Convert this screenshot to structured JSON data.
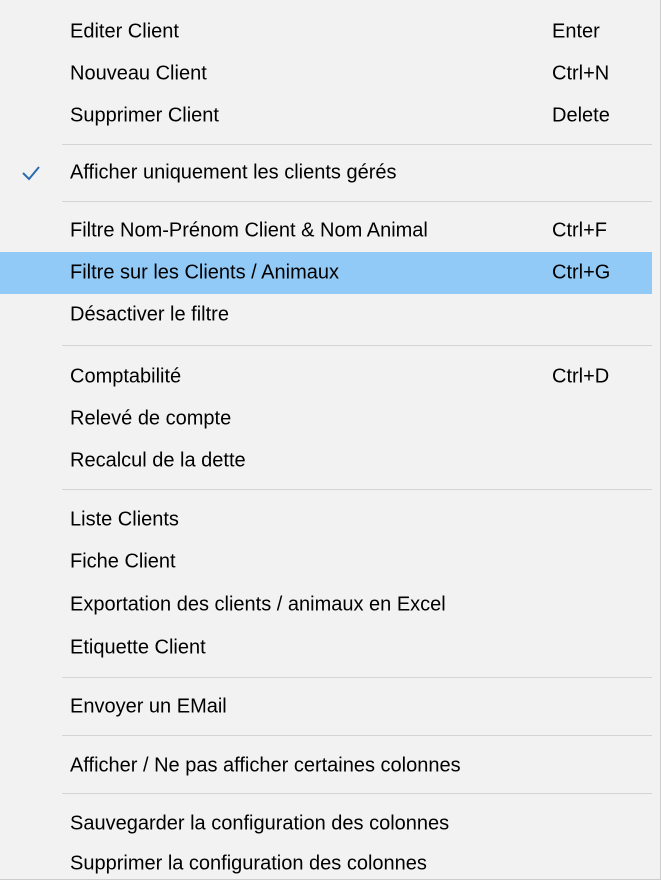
{
  "menu": {
    "items": [
      {
        "label": "Editer Client",
        "shortcut": "Enter"
      },
      {
        "label": "Nouveau Client",
        "shortcut": "Ctrl+N"
      },
      {
        "label": "Supprimer Client",
        "shortcut": "Delete"
      },
      {
        "label": "Afficher uniquement les clients gérés",
        "shortcut": "",
        "checked": true
      },
      {
        "label": "Filtre Nom-Prénom Client & Nom Animal",
        "shortcut": "Ctrl+F"
      },
      {
        "label": "Filtre sur les Clients / Animaux",
        "shortcut": "Ctrl+G",
        "highlighted": true
      },
      {
        "label": "Désactiver le filtre",
        "shortcut": ""
      },
      {
        "label": "Comptabilité",
        "shortcut": "Ctrl+D"
      },
      {
        "label": "Relevé de compte",
        "shortcut": ""
      },
      {
        "label": "Recalcul de la dette",
        "shortcut": ""
      },
      {
        "label": "Liste Clients",
        "shortcut": ""
      },
      {
        "label": "Fiche Client",
        "shortcut": ""
      },
      {
        "label": "Exportation des clients / animaux en Excel",
        "shortcut": ""
      },
      {
        "label": "Etiquette Client",
        "shortcut": ""
      },
      {
        "label": "Envoyer un EMail",
        "shortcut": ""
      },
      {
        "label": "Afficher / Ne pas afficher certaines colonnes",
        "shortcut": ""
      },
      {
        "label": "Sauvegarder la configuration des colonnes",
        "shortcut": ""
      },
      {
        "label": "Supprimer la configuration des colonnes",
        "shortcut": ""
      }
    ]
  },
  "colors": {
    "menu_background": "#f2f2f2",
    "highlight": "#91c9f7",
    "check_mark": "#2b6cb0",
    "separator": "#d4d4d4"
  },
  "icons": {
    "check": "check-icon"
  }
}
